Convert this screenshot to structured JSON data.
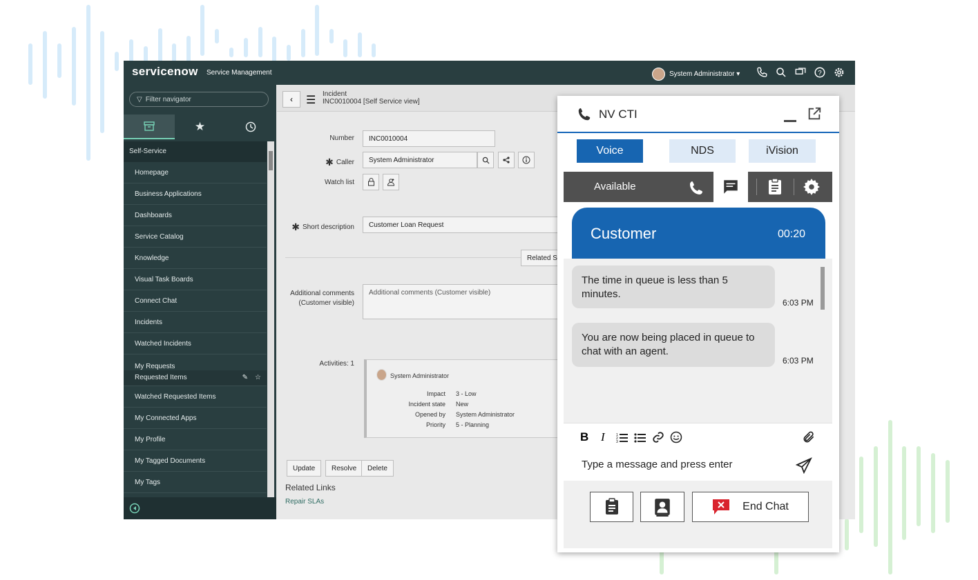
{
  "servicenow": {
    "logo": "servicenow",
    "product": "Service Management",
    "user": "System Administrator ▾",
    "filter_placeholder": "Filter navigator",
    "nav_header": "Self-Service",
    "nav_items": [
      "Homepage",
      "Business Applications",
      "Dashboards",
      "Service Catalog",
      "Knowledge",
      "Visual Task Boards",
      "Connect Chat",
      "Incidents",
      "Watched Incidents",
      "My Requests",
      "Requested Items",
      "Watched Requested Items",
      "My Connected Apps",
      "My Profile",
      "My Tagged Documents",
      "My Tags"
    ],
    "form": {
      "title": "Incident",
      "subtitle": "INC0010004 [Self Service view]",
      "number_label": "Number",
      "number_value": "INC0010004",
      "caller_label": "Caller",
      "caller_value": "System Administrator",
      "watchlist_label": "Watch list",
      "short_desc_label": "Short description",
      "short_desc_value": "Customer Loan Request",
      "related_search": "Related Se",
      "comments_label_1": "Additional comments",
      "comments_label_2": "(Customer visible)",
      "comments_placeholder": "Additional comments (Customer visible)",
      "activities_label": "Activities: 1",
      "activity": {
        "author": "System Administrator",
        "fields": [
          {
            "k": "Impact",
            "v": "3 - Low"
          },
          {
            "k": "Incident state",
            "v": "New"
          },
          {
            "k": "Opened by",
            "v": "System Administrator"
          },
          {
            "k": "Priority",
            "v": "5 - Planning"
          }
        ]
      },
      "buttons": [
        "Update",
        "Resolve",
        "Delete"
      ],
      "related_links": "Related Links",
      "repair_slas": "Repair SLAs"
    }
  },
  "cti": {
    "title": "NV CTI",
    "tabs": [
      "Voice",
      "NDS",
      "iVision"
    ],
    "status": "Available",
    "customer_label": "Customer",
    "timer": "00:20",
    "messages": [
      {
        "text": "The time in queue is less than 5 minutes.",
        "time": "6:03 PM"
      },
      {
        "text": "You are now being placed in queue to chat with an agent.",
        "time": "6:03 PM"
      }
    ],
    "format_buttons": [
      "B",
      "I"
    ],
    "input_placeholder": "Type a message and press enter",
    "end_chat": "End Chat",
    "colors": {
      "accent": "#1765b1",
      "status_bar": "#505050",
      "end_red": "#d9232d"
    }
  }
}
